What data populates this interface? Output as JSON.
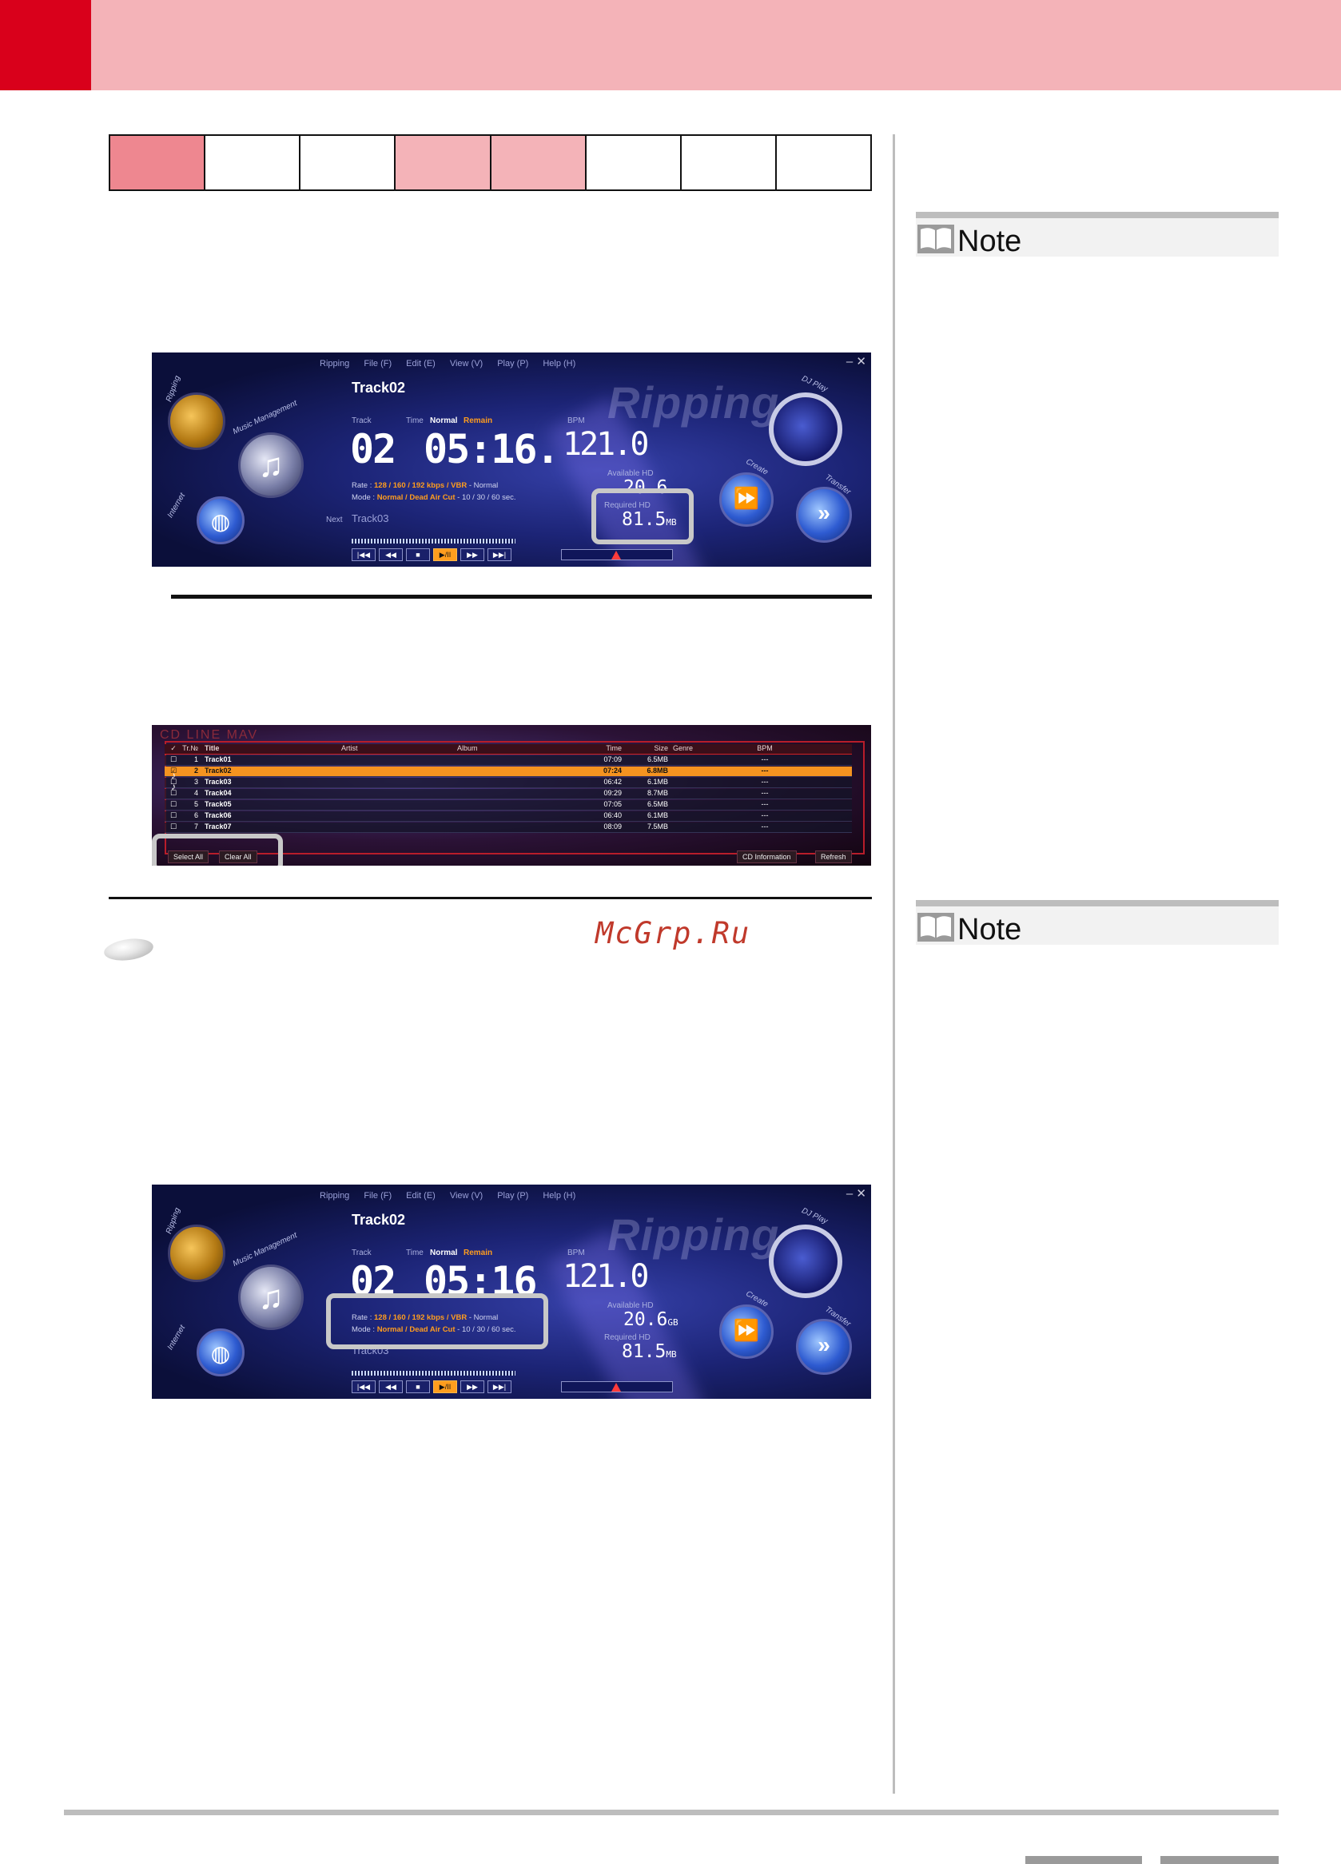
{
  "note_sections": [
    {
      "label": "Note"
    },
    {
      "label": "Note"
    }
  ],
  "watermark": "McGrp.Ru",
  "player_screen": {
    "menu": [
      "Ripping",
      "File (F)",
      "Edit (E)",
      "View (V)",
      "Play (P)",
      "Help (H)"
    ],
    "track_title": "Track02",
    "track_label": "Track",
    "time_label": "Time",
    "time_mode_normal": "Normal",
    "time_mode_remain": "Remain",
    "track_num": "02",
    "time_value": "05:16.",
    "time_value_2": "05:16",
    "bpm_label": "BPM",
    "bpm_value": "121.0",
    "available_hd_label": "Available HD",
    "available_hd_value": "20.6",
    "available_hd_unit": "GB",
    "required_hd_label": "Required HD",
    "required_hd_value": "81.5",
    "required_hd_unit": "MB",
    "rate_prefix": "Rate : ",
    "rate_values": "128 / 160 / 192 kbps / VBR",
    "rate_suffix": " - Normal",
    "mode_prefix": "Mode : ",
    "mode_values": "Normal / Dead Air Cut",
    "mode_suffix": " - 10 / 30 / 60 sec.",
    "next_label": "Next",
    "next_track": "Track03",
    "ripping_word": "Ripping",
    "arc_labels": [
      "Ripping",
      "Music Management",
      "Internet",
      "DJ Play",
      "Create",
      "Transfer"
    ]
  },
  "track_list": {
    "columns": [
      "Tr.№",
      "Title",
      "Artist",
      "Album",
      "Time",
      "Size",
      "Genre",
      "BPM"
    ],
    "rows": [
      {
        "no": "1",
        "title": "Track01",
        "time": "07:09",
        "size": "6.5MB",
        "bpm": "---"
      },
      {
        "no": "2",
        "title": "Track02",
        "time": "07:24",
        "size": "6.8MB",
        "bpm": "---"
      },
      {
        "no": "3",
        "title": "Track03",
        "time": "06:42",
        "size": "6.1MB",
        "bpm": "---"
      },
      {
        "no": "4",
        "title": "Track04",
        "time": "09:29",
        "size": "8.7MB",
        "bpm": "---"
      },
      {
        "no": "5",
        "title": "Track05",
        "time": "07:05",
        "size": "6.5MB",
        "bpm": "---"
      },
      {
        "no": "6",
        "title": "Track06",
        "time": "06:40",
        "size": "6.1MB",
        "bpm": "---"
      },
      {
        "no": "7",
        "title": "Track07",
        "time": "08:09",
        "size": "7.5MB",
        "bpm": "---"
      }
    ],
    "select_all": "Select All",
    "clear_all": "Clear All",
    "cd_information": "CD Information",
    "refresh": "Refresh",
    "line_rec_label": "CD LINE MAV"
  },
  "colors": {
    "header_pink": "#f4b3b8",
    "header_red": "#d9001b",
    "tab_active": "#ee8790",
    "accent_orange": "#ff9d1e"
  }
}
